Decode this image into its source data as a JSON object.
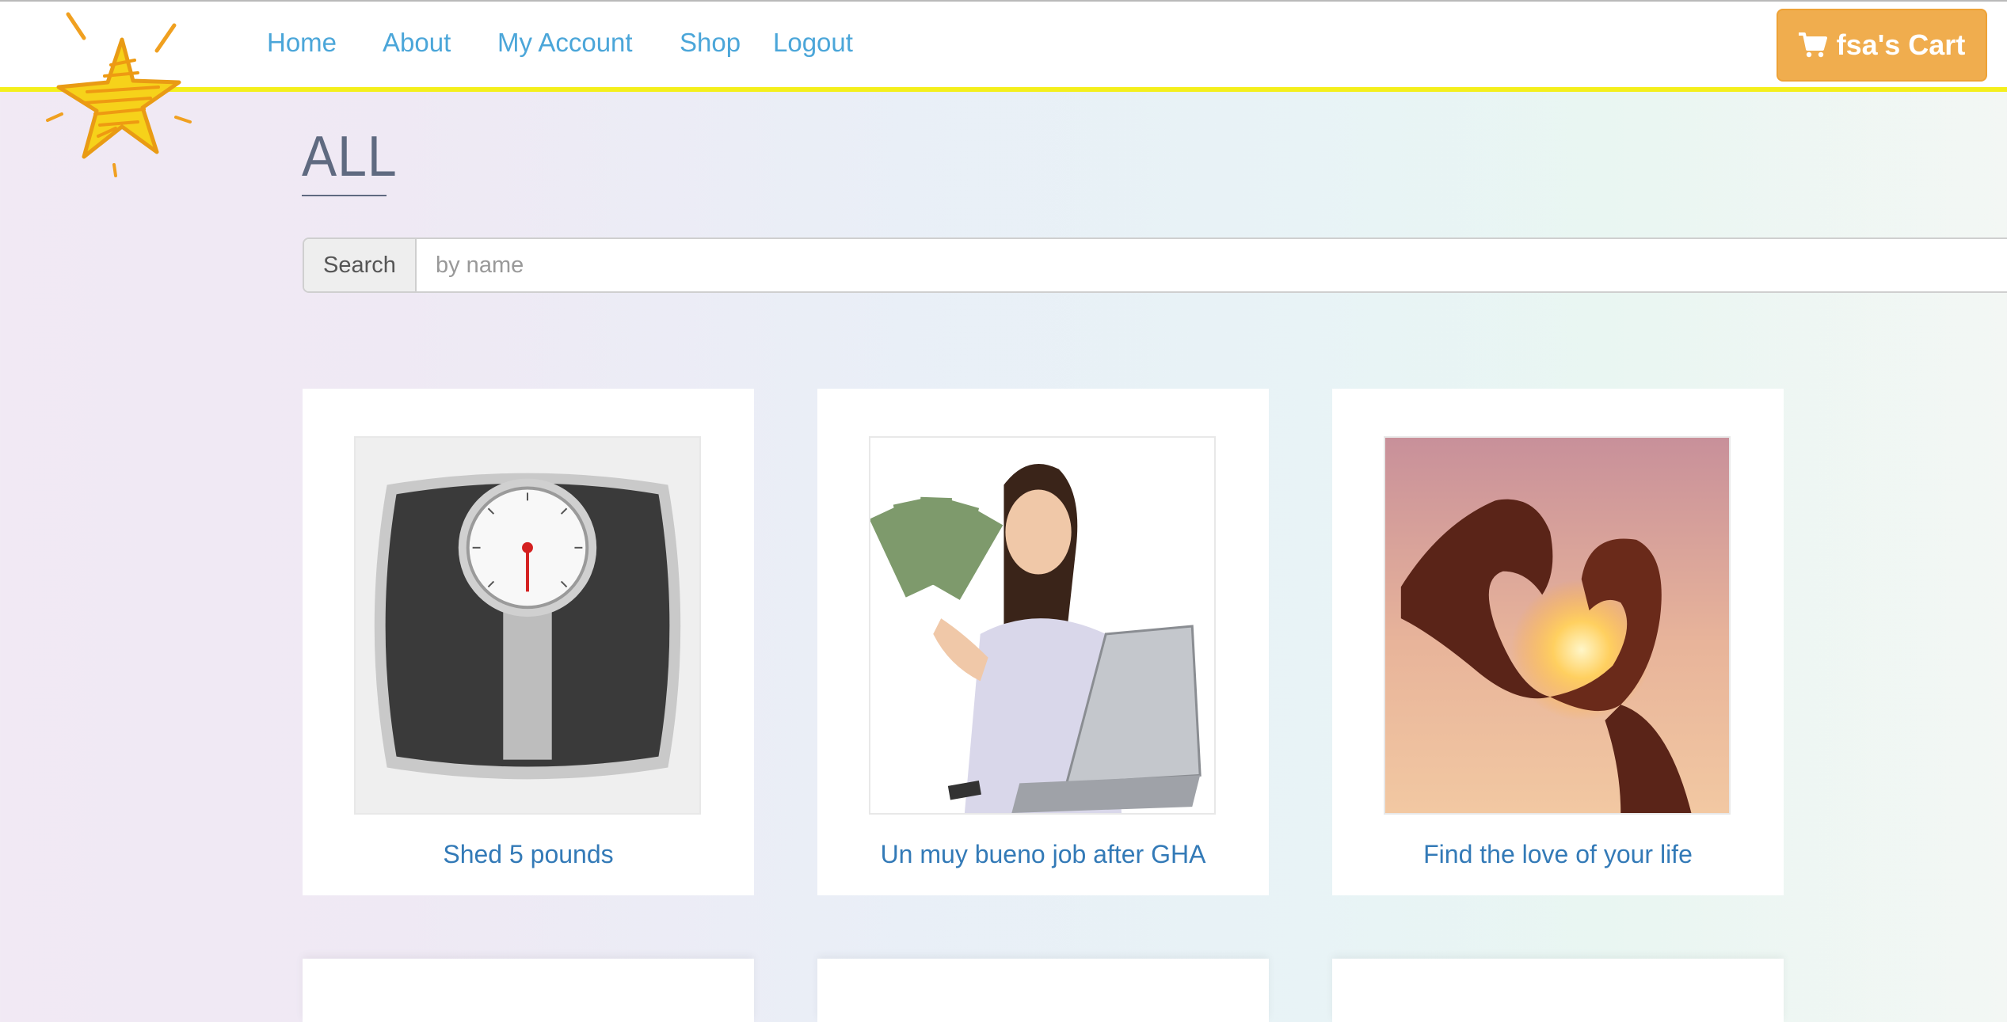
{
  "header": {
    "nav": [
      {
        "label": "Home"
      },
      {
        "label": "About"
      },
      {
        "label": "My Account"
      },
      {
        "label": "Shop"
      },
      {
        "label": "Logout"
      }
    ],
    "cart_label": "fsa's Cart",
    "logo_icon": "star-logo-icon",
    "cart_icon": "shopping-cart-icon"
  },
  "main": {
    "title": "ALL",
    "search": {
      "addon_label": "Search",
      "placeholder": "by name",
      "value": ""
    },
    "products": [
      {
        "title": "Shed 5 pounds",
        "image_icon": "bathroom-scale-image"
      },
      {
        "title": "Un muy bueno job after GHA",
        "image_icon": "woman-with-money-and-laptop-image"
      },
      {
        "title": "Find the love of your life",
        "image_icon": "heart-hands-sunset-image"
      }
    ]
  },
  "colors": {
    "nav_link": "#4ba6d9",
    "cart_button": "#f0ad4e",
    "header_border": "#f4ef1c",
    "card_title": "#337ab7",
    "page_title": "#5f6a80"
  }
}
